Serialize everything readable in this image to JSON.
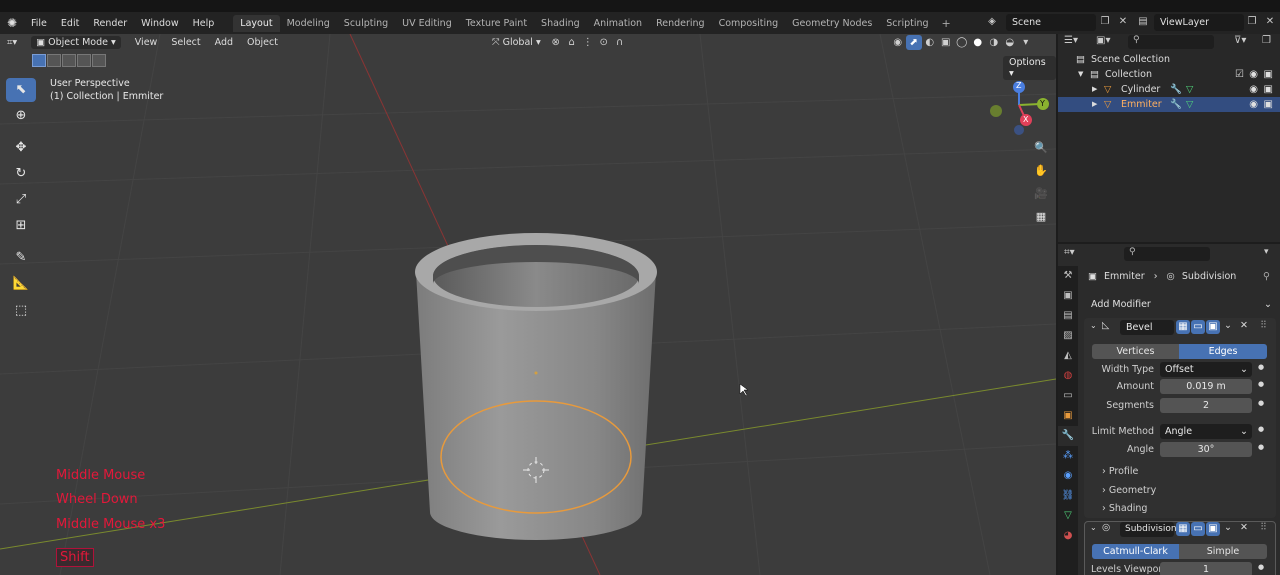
{
  "menu": [
    "File",
    "Edit",
    "Render",
    "Window",
    "Help"
  ],
  "workspaces": [
    "Layout",
    "Modeling",
    "Sculpting",
    "UV Editing",
    "Texture Paint",
    "Shading",
    "Animation",
    "Rendering",
    "Compositing",
    "Geometry Nodes",
    "Scripting"
  ],
  "scene": "Scene",
  "view_layer": "ViewLayer",
  "viewport": {
    "mode": "Object Mode",
    "menus": [
      "View",
      "Select",
      "Add",
      "Object"
    ],
    "orientation": "Global",
    "options_label": "Options",
    "perspective": "User Perspective",
    "context": "(1) Collection | Emmiter",
    "gizmo": {
      "x": "X",
      "y": "Y",
      "z": "Z"
    }
  },
  "keystrokes": [
    "Middle Mouse",
    "Wheel Down",
    "Middle Mouse x3"
  ],
  "key_modifier": "Shift",
  "outliner": {
    "scene_collection": "Scene Collection",
    "collection": "Collection",
    "objects": [
      "Cylinder",
      "Emmiter"
    ]
  },
  "properties": {
    "breadcrumb_object": "Emmiter",
    "breadcrumb_modifier": "Subdivision",
    "add_modifier": "Add Modifier",
    "bevel": {
      "name": "Bevel",
      "affect_vertices": "Vertices",
      "affect_edges": "Edges",
      "width_type_label": "Width Type",
      "width_type": "Offset",
      "amount_label": "Amount",
      "amount": "0.019 m",
      "segments_label": "Segments",
      "segments": "2",
      "limit_method_label": "Limit Method",
      "limit_method": "Angle",
      "angle_label": "Angle",
      "angle": "30°",
      "subpanels": [
        "Profile",
        "Geometry",
        "Shading"
      ]
    },
    "subdivision": {
      "name": "Subdivision",
      "catmull": "Catmull-Clark",
      "simple": "Simple",
      "levels_label": "Levels Viewpor",
      "levels": "1"
    }
  },
  "colors": {
    "accent": "#4772b3",
    "selection": "#e89a3c",
    "keystroke": "#e3183a"
  }
}
